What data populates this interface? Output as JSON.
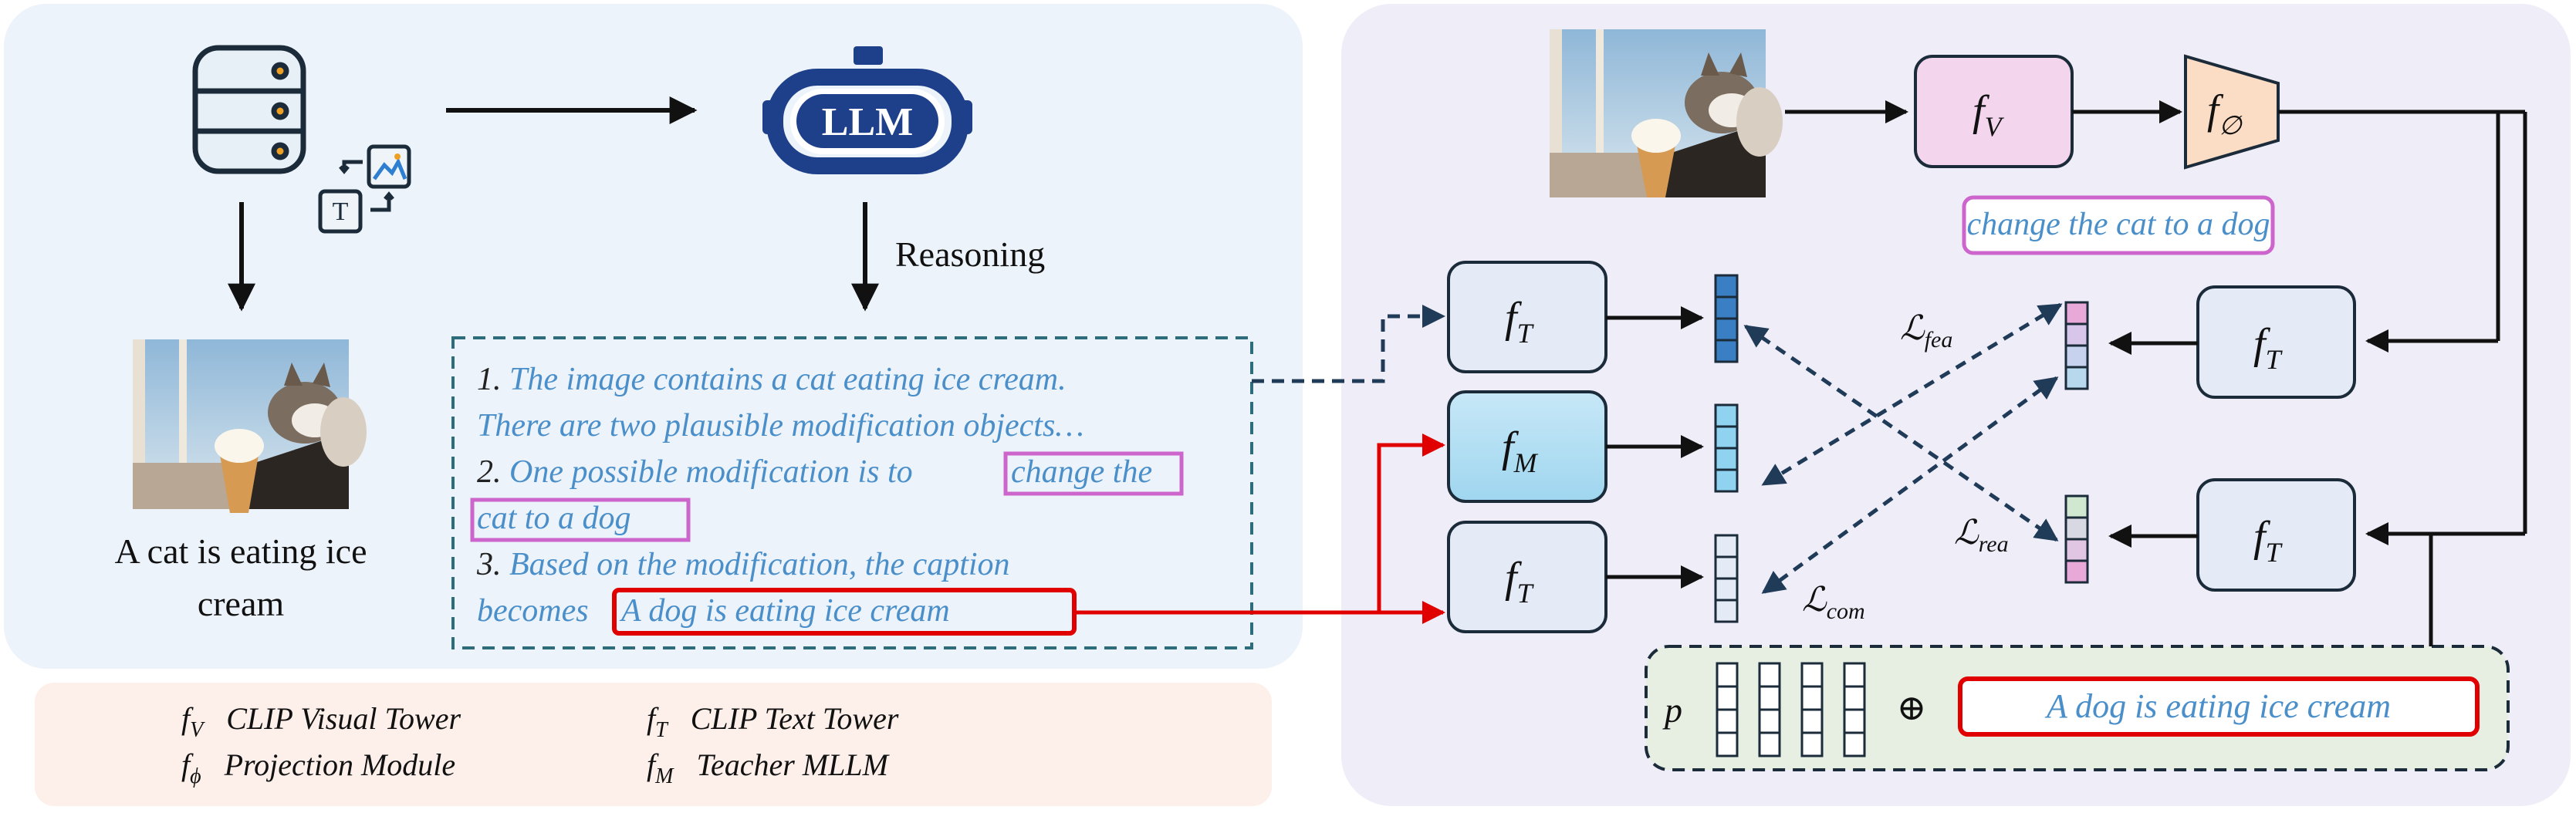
{
  "left_panel": {
    "caption_line1": "A cat is eating ice",
    "caption_line2": "cream",
    "reasoning_label": "Reasoning",
    "llm_logo_text": "LLM",
    "tt_icon_letter": "T"
  },
  "reasoning_box": {
    "line1_num": "1.",
    "line1_text": " The image contains a cat eating ice cream.",
    "line2_text": "There are two plausible modification objects…",
    "line3_num": "2.",
    "line3_text": " One possible modification is to ",
    "line3_highlight": "change the",
    "line4_highlight": "cat to a dog",
    "line5_num": "3.",
    "line5_text": " Based on the modification, the caption",
    "line6_text": "becomes ",
    "line6_highlight": "A dog is eating ice cream"
  },
  "right_panel": {
    "fv": {
      "base": "f",
      "sub": "V"
    },
    "fphi": {
      "base": "f",
      "sub": "∅"
    },
    "instruction": "change the cat to a dog",
    "ft": {
      "base": "f",
      "sub": "T"
    },
    "fm": {
      "base": "f",
      "sub": "M"
    },
    "loss_fea": {
      "base": "ℒ",
      "sub": "fea"
    },
    "loss_rea": {
      "base": "ℒ",
      "sub": "rea"
    },
    "loss_com": {
      "base": "ℒ",
      "sub": "com"
    },
    "prompt_label": "p",
    "oplus": "⊕",
    "target_caption": "A dog is eating ice cream"
  },
  "legend": {
    "items": [
      {
        "base": "f",
        "sub": "V",
        "text": "CLIP Visual Tower"
      },
      {
        "base": "f",
        "sub": "T",
        "text": "CLIP Text Tower"
      },
      {
        "base": "f",
        "sub": "ϕ",
        "text": "Projection Module"
      },
      {
        "base": "f",
        "sub": "M",
        "text": "Teacher MLLM"
      }
    ]
  },
  "colors": {
    "left_panel_bg": "#edf3fa",
    "right_panel_bg": "#efedf8",
    "legend_bg": "#fdf0ea",
    "prompt_box_bg": "#e6efe2",
    "text_blue": "#4a8fc9",
    "highlight_pink": "#cc66cc",
    "highlight_red": "#e00000",
    "arrow_dark": "#1f3b57"
  }
}
